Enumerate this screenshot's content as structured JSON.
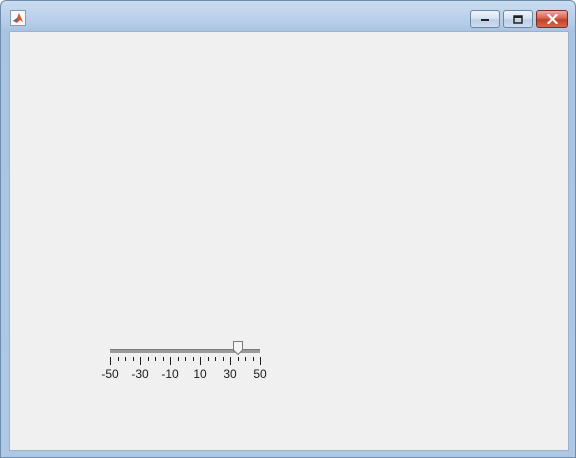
{
  "window": {
    "title": "",
    "controls": {
      "minimize_icon": "minimize-icon",
      "maximize_icon": "maximize-icon",
      "close_icon": "close-icon"
    },
    "app_icon": "matlab-icon"
  },
  "slider": {
    "min": -50,
    "max": 50,
    "value": 35,
    "major_step": 20,
    "minor_step": 5,
    "tick_labels": [
      "-50",
      "-30",
      "-10",
      "10",
      "30",
      "50"
    ]
  },
  "colors": {
    "accent_close": "#c2402a",
    "client_bg": "#f0f0f0"
  }
}
